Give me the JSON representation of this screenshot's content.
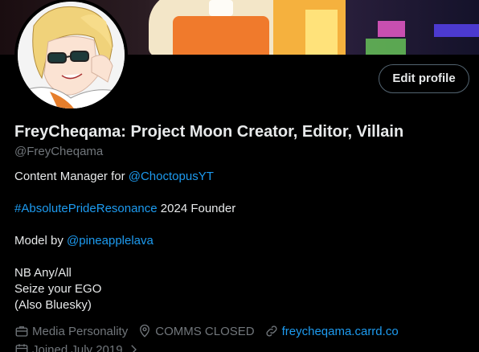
{
  "profile": {
    "display_name": "FreyCheqama: Project Moon Creator, Editor, Villain",
    "handle": "@FreyCheqama",
    "edit_label": "Edit profile"
  },
  "bio": {
    "line1_prefix": "Content Manager for ",
    "line1_link": "@ChoctopusYT",
    "line2_link": "#AbsolutePrideResonance",
    "line2_suffix": " 2024 Founder",
    "line3_prefix": "Model by ",
    "line3_link": "@pineapplelava",
    "line4": "NB Any/All",
    "line5": "Seize your EGO",
    "line6": "(Also Bluesky)"
  },
  "meta": {
    "category": "Media Personality",
    "location": "COMMS CLOSED",
    "website": "freycheqama.carrd.co",
    "joined": "Joined July 2019"
  },
  "icons": {
    "category": "briefcase-icon",
    "location": "location-pin-icon",
    "website": "link-icon",
    "joined": "calendar-icon"
  },
  "colors": {
    "background": "#000000",
    "text": "#e7e9ea",
    "muted": "#71767b",
    "link": "#1d9bf0",
    "border": "#536471"
  }
}
